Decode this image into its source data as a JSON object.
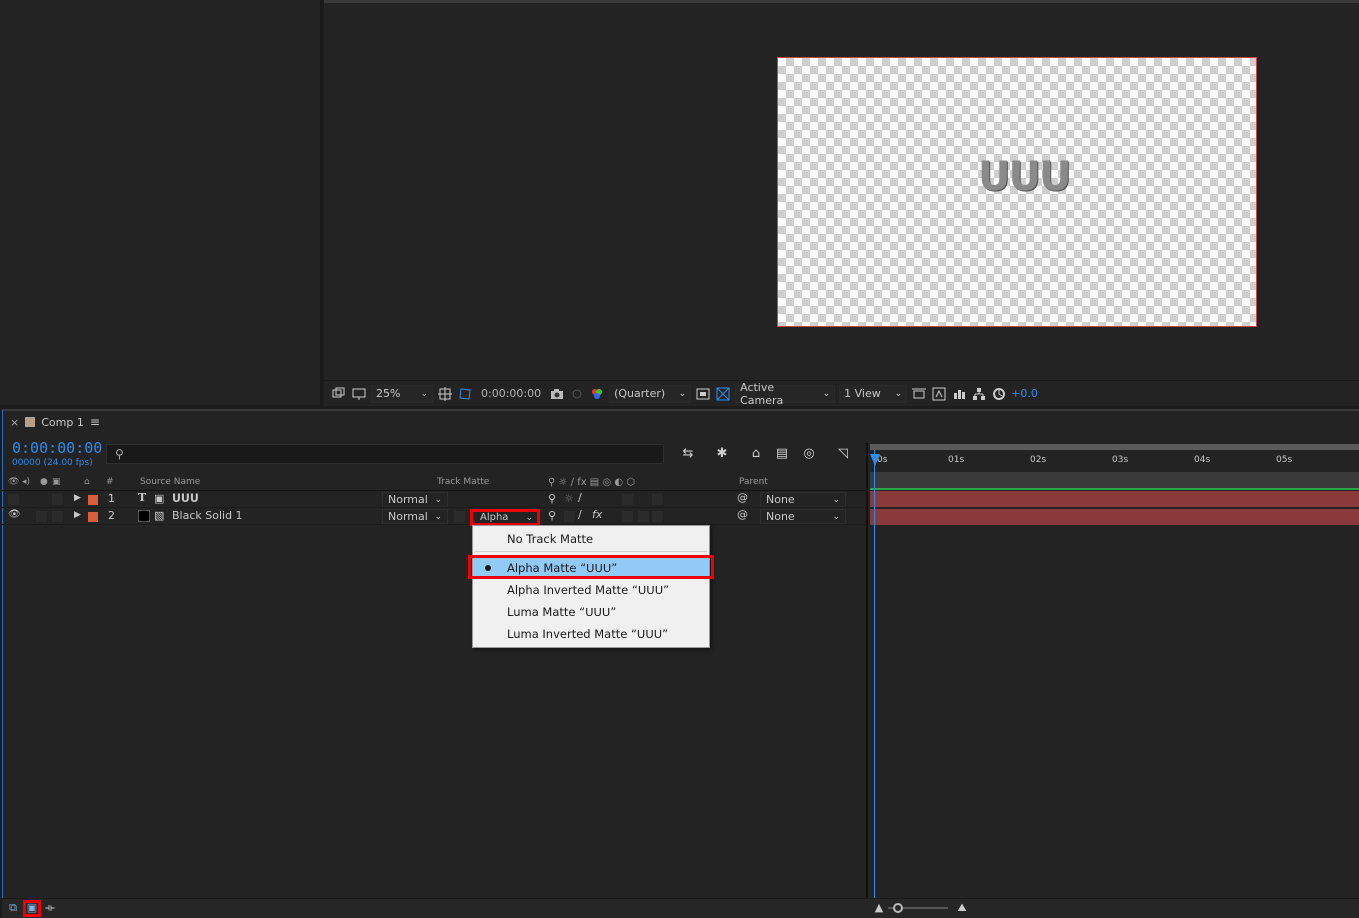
{
  "viewer": {
    "canvas_text": "ᑌᑌᑌ",
    "zoom": "25%",
    "timecode": "0:00:00:00",
    "resolution": "(Quarter)",
    "camera": "Active Camera",
    "views": "1 View",
    "exposure": "+0.0"
  },
  "timeline": {
    "tab_title": "Comp 1",
    "current_time": "0:00:00:00",
    "fps_readout": "00000 (24.00 fps)",
    "columns": {
      "number": "#",
      "source_name": "Source Name",
      "track_matte": "Track Matte",
      "parent": "Parent"
    },
    "layers": [
      {
        "num": "1",
        "type_icon": "T",
        "name": "ᑌᑌᑌ",
        "mode": "Normal",
        "track_matte": "",
        "parent": "None"
      },
      {
        "num": "2",
        "type_icon": "",
        "name": "Black Solid 1",
        "mode": "Normal",
        "track_matte": "Alpha",
        "parent": "None"
      }
    ],
    "ruler_ticks": [
      "0s",
      "01s",
      "02s",
      "03s",
      "04s",
      "05s"
    ]
  },
  "track_matte_menu": {
    "items": [
      {
        "label": "No Track Matte",
        "selected": false
      },
      {
        "label": "Alpha Matte “ᑌᑌᑌ”",
        "selected": true
      },
      {
        "label": "Alpha Inverted Matte “ᑌᑌᑌ”",
        "selected": false
      },
      {
        "label": "Luma Matte “ᑌᑌᑌ”",
        "selected": false
      },
      {
        "label": "Luma Inverted Matte “ᑌᑌᑌ”",
        "selected": false
      }
    ]
  },
  "colors": {
    "accent_blue": "#2d8ceb",
    "layer_bar": "#8a3a3a",
    "highlight_red": "#e00000",
    "menu_selected": "#91c9f7"
  }
}
